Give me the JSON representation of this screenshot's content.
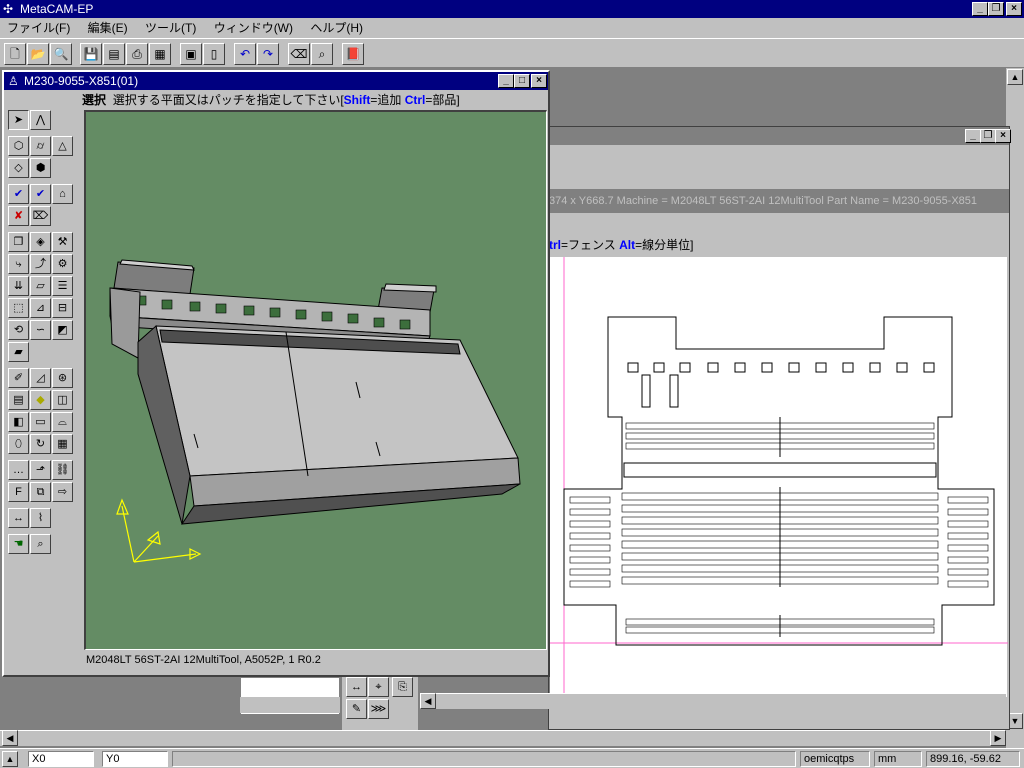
{
  "app": {
    "title": "MetaCAM-EP"
  },
  "menu": [
    "ファイル(F)",
    "編集(E)",
    "ツール(T)",
    "ウィンドウ(W)",
    "ヘルプ(H)"
  ],
  "toolbar_icons": [
    "new-icon",
    "open-icon",
    "preview-icon",
    "save-icon",
    "save-all-icon",
    "print-setup-icon",
    "print-preview-icon",
    "nest-icon",
    "sheet-icon",
    "undo-icon",
    "redo-icon",
    "erase-icon",
    "zoom-window-icon",
    "book-icon"
  ],
  "back_window": {
    "info": "374 x Y668.7  Machine = M2048LT 56ST-2AI 12MultiTool  Part Name = M230-9055-X851",
    "hint_key": "trl",
    "hint_text_1": "=フェンス ",
    "hint_key2": "Alt",
    "hint_text_2": "=線分単位]"
  },
  "doc3d": {
    "title": "M230-9055-X851(01)",
    "prompt_mode": "選択",
    "prompt_text": "選択する平面又はパッチを指定して下さい[",
    "prompt_shift": "Shift",
    "prompt_shift_text": "=追加 ",
    "prompt_ctrl": "Ctrl",
    "prompt_ctrl_text": "=部品]",
    "status": "M2048LT 56ST-2AI 12MultiTool, A5052P, 1  R0.2"
  },
  "statusbar": {
    "x_label": "X0",
    "y_label": "Y0",
    "user": "oemicqtps",
    "unit": "mm",
    "coords": "899.16, -59.62"
  },
  "colors": {
    "titlebar": "#000080",
    "viewport": "#648c64",
    "face": "#c0c0c0",
    "highlight_blue": "#0000ff"
  }
}
